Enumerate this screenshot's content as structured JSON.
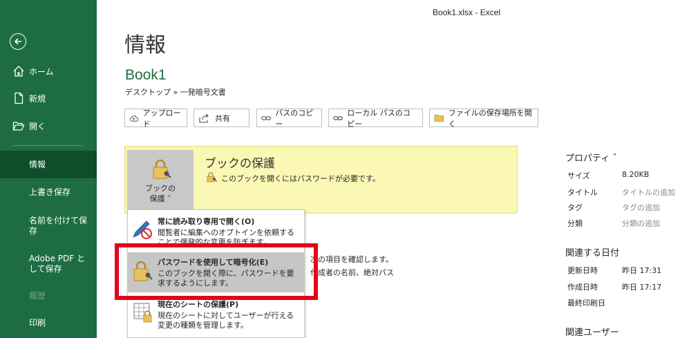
{
  "window": {
    "title": "Book1.xlsx  -  Excel"
  },
  "sidebar": {
    "items": [
      {
        "label": "ホーム"
      },
      {
        "label": "新規"
      },
      {
        "label": "開く"
      },
      {
        "label": "情報"
      },
      {
        "label": "上書き保存"
      },
      {
        "label": "名前を付けて保存"
      },
      {
        "label": "Adobe PDF として保存"
      },
      {
        "label": "履歴"
      },
      {
        "label": "印刷"
      }
    ]
  },
  "main": {
    "page_title": "情報",
    "book_name": "Book1",
    "breadcrumb": "デスクトップ » 一発暗号文書",
    "buttons": {
      "upload": "アップロード",
      "share": "共有",
      "copy_path": "パスのコピー",
      "copy_local_path": "ローカル パスのコピー",
      "open_location": "ファイルの保存場所を開く"
    },
    "protect": {
      "tile_label_1": "ブックの",
      "tile_label_2": "保護 ˇ",
      "heading": "ブックの保護",
      "description": "このブックを開くにはパスワードが必要です。"
    },
    "dropdown": {
      "items": [
        {
          "title": "常に読み取り専用で開く(O)",
          "desc": "閲覧者に編集へのオプトインを依頼することで偶発的な変更を防ぎます。"
        },
        {
          "title": "パスワードを使用して暗号化(E)",
          "desc": "このブックを開く際に、パスワードを要求するようにします。"
        },
        {
          "title": "現在のシートの保護(P)",
          "desc": "現在のシートに対してユーザーが行える変更の種類を管理します。"
        }
      ]
    },
    "behind_text": {
      "line1": "次の項目を確認します。",
      "line2": "作成者の名前、絶対パス"
    }
  },
  "properties": {
    "heading": "プロパティ ˇ",
    "rows": [
      {
        "key": "サイズ",
        "value": "8.20KB"
      },
      {
        "key": "タイトル",
        "value": "タイトルの追加"
      },
      {
        "key": "タグ",
        "value": "タグの追加"
      },
      {
        "key": "分類",
        "value": "分類の追加"
      }
    ],
    "dates_heading": "関連する日付",
    "dates": [
      {
        "key": "更新日時",
        "value": "昨日 17:31"
      },
      {
        "key": "作成日時",
        "value": "昨日 17:17"
      },
      {
        "key": "最終印刷日",
        "value": ""
      }
    ],
    "users_heading": "関連ユーザー"
  }
}
